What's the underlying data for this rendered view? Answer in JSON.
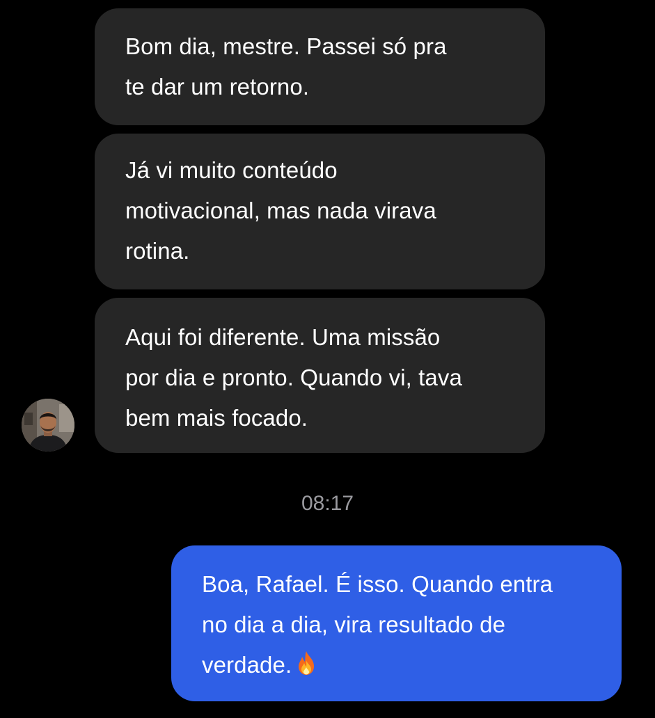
{
  "conversation": {
    "incoming_messages": [
      {
        "lines": [
          "Bom dia, mestre. Passei só pra",
          "te dar um retorno."
        ]
      },
      {
        "lines": [
          "Já vi muito conteúdo",
          "motivacional, mas nada virava",
          "rotina."
        ]
      },
      {
        "lines": [
          "Aqui foi diferente. Uma missão",
          "por dia e pronto. Quando vi, tava",
          "bem mais focado."
        ]
      }
    ],
    "timestamp": "08:17",
    "outgoing_message": {
      "lines": [
        "Boa, Rafael. É isso. Quando entra",
        "no dia a dia, vira resultado de",
        "verdade."
      ],
      "emoji_icon": "fire-icon"
    }
  },
  "avatar": {
    "icon": "person-photo"
  },
  "colors": {
    "background": "#000000",
    "incoming_bubble": "#262626",
    "outgoing_bubble": "#2f5fe6",
    "text": "#ffffff",
    "timestamp": "#9a9a9f"
  }
}
